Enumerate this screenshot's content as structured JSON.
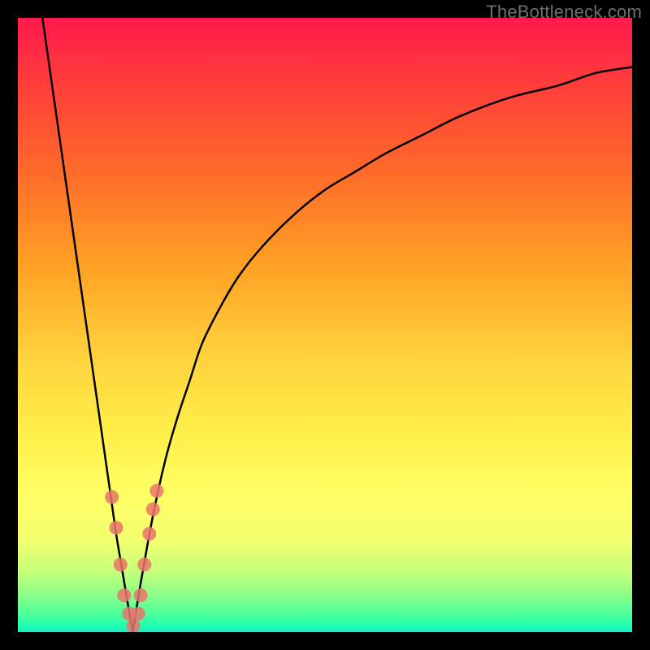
{
  "watermark": {
    "text": "TheBottleneck.com"
  },
  "chart_data": {
    "type": "line",
    "title": "",
    "xlabel": "",
    "ylabel": "",
    "xlim": [
      0,
      100
    ],
    "ylim": [
      0,
      100
    ],
    "gradient_stops": [
      {
        "pos": 0,
        "color": "#ff1a4d"
      },
      {
        "pos": 10,
        "color": "#ff3b3b"
      },
      {
        "pos": 25,
        "color": "#ff6a2a"
      },
      {
        "pos": 40,
        "color": "#ffa024"
      },
      {
        "pos": 55,
        "color": "#ffd23c"
      },
      {
        "pos": 68,
        "color": "#fff04a"
      },
      {
        "pos": 78,
        "color": "#ffff66"
      },
      {
        "pos": 85,
        "color": "#f3ff6f"
      },
      {
        "pos": 90,
        "color": "#c7ff7a"
      },
      {
        "pos": 94,
        "color": "#8bff88"
      },
      {
        "pos": 97,
        "color": "#4dff9a"
      },
      {
        "pos": 99,
        "color": "#1fffb0"
      },
      {
        "pos": 100,
        "color": "#17edc6"
      }
    ],
    "series": [
      {
        "name": "left-branch",
        "x": [
          4,
          5,
          6,
          7,
          8,
          9,
          10,
          11,
          12,
          13,
          14,
          15,
          16,
          17,
          18,
          18.7
        ],
        "values": [
          100,
          93,
          86,
          79,
          72,
          65,
          58,
          51,
          44,
          37,
          30,
          23,
          16,
          10,
          4,
          0
        ]
      },
      {
        "name": "right-branch",
        "x": [
          18.7,
          20,
          22,
          24,
          26,
          28,
          30,
          33,
          36,
          40,
          45,
          50,
          55,
          60,
          66,
          72,
          80,
          88,
          94,
          100
        ],
        "values": [
          0,
          8,
          19,
          28,
          35,
          41,
          47,
          53,
          58,
          63,
          68,
          72,
          75,
          78,
          81,
          84,
          87,
          89,
          91,
          92
        ]
      }
    ],
    "scatter": {
      "name": "highlight-points",
      "color": "#e9756b",
      "points": [
        {
          "x": 15.3,
          "y": 22
        },
        {
          "x": 16.0,
          "y": 17
        },
        {
          "x": 16.7,
          "y": 11
        },
        {
          "x": 17.3,
          "y": 6
        },
        {
          "x": 18.1,
          "y": 3
        },
        {
          "x": 18.8,
          "y": 1
        },
        {
          "x": 19.6,
          "y": 3
        },
        {
          "x": 20.0,
          "y": 6
        },
        {
          "x": 20.6,
          "y": 11
        },
        {
          "x": 21.4,
          "y": 16
        },
        {
          "x": 22.0,
          "y": 20
        },
        {
          "x": 22.6,
          "y": 23
        }
      ]
    },
    "optimum_x": 18.7
  }
}
